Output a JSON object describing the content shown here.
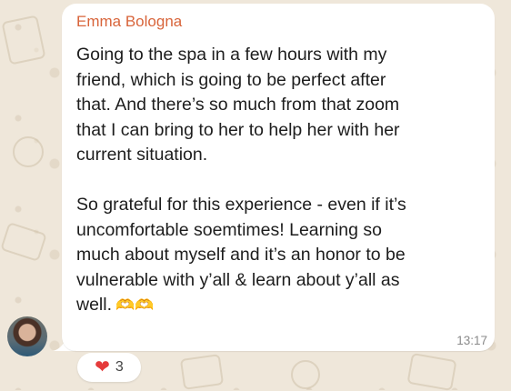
{
  "message": {
    "sender": "Emma Bologna",
    "body": "Going to the spa in a few hours with my\nfriend, which is going to be perfect after\nthat. And there’s so much from that zoom\nthat I can bring to her to help her with her\ncurrent situation.\n\nSo grateful for this experience - even if it’s\nuncomfortable soemtimes! Learning so\nmuch about myself and it’s an honor to be\nvulnerable with y’all & learn about y’all as\nwell.",
    "emoji": "🫶🫶",
    "time": "13:17"
  },
  "reaction": {
    "icon": "heart",
    "count": "3"
  },
  "colors": {
    "sender": "#d8643a",
    "background": "#efe7da",
    "bubble": "#ffffff",
    "heart": "#e53b3b"
  }
}
